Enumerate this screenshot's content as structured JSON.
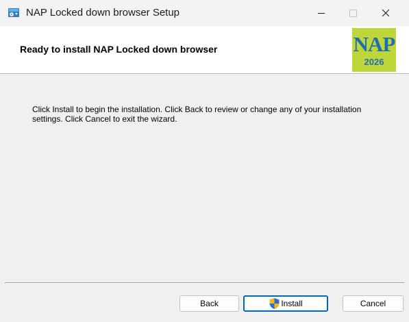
{
  "window": {
    "title": "NAP Locked down browser Setup",
    "icon": "installer-package-icon",
    "controls": [
      "minimize-icon",
      "maximize-icon",
      "close-icon"
    ]
  },
  "banner": {
    "heading": "Ready to install NAP Locked down browser",
    "logo_text": "NAP",
    "logo_year": "2026",
    "logo_bg": "#bfd63a",
    "logo_fg": "#1e6fae"
  },
  "main": {
    "instructions": "Click Install to begin the installation. Click Back to review or change any of your installation settings. Click Cancel to exit the wizard."
  },
  "buttons": {
    "back": "Back",
    "install": "Install",
    "install_icon": "uac-shield-icon",
    "cancel": "Cancel",
    "accent": "#0067c0"
  }
}
